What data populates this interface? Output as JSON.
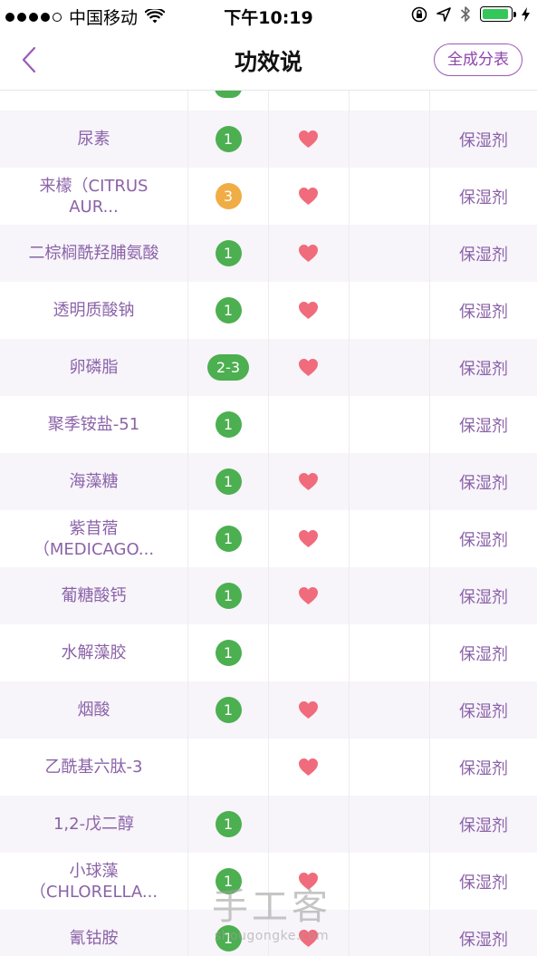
{
  "status_bar": {
    "carrier": "中国移动",
    "time": "下午10:19"
  },
  "nav": {
    "title": "功效说",
    "full_table_label": "全成分表"
  },
  "colors": {
    "accent": "#8e44ad",
    "ingredient_text": "#8b63a8",
    "safe_green": "#4caf50",
    "risk_orange": "#f0ad45",
    "heart_pink": "#f06b7b",
    "row_alt_bg": "#f7f4fa"
  },
  "rows": [
    {
      "name_lines": [
        "尿素"
      ],
      "score": "1",
      "score_color": "green",
      "acne_heart": true,
      "function": "保湿剂"
    },
    {
      "name_lines": [
        "来檬（CITRUS",
        "AUR..."
      ],
      "score": "3",
      "score_color": "orange",
      "acne_heart": true,
      "function": "保湿剂"
    },
    {
      "name_lines": [
        "二棕榈酰羟脯氨酸"
      ],
      "score": "1",
      "score_color": "green",
      "acne_heart": true,
      "function": "保湿剂"
    },
    {
      "name_lines": [
        "透明质酸钠"
      ],
      "score": "1",
      "score_color": "green",
      "acne_heart": true,
      "function": "保湿剂"
    },
    {
      "name_lines": [
        "卵磷脂"
      ],
      "score": "2-3",
      "score_color": "green",
      "acne_heart": true,
      "function": "保湿剂"
    },
    {
      "name_lines": [
        "聚季铵盐-51"
      ],
      "score": "1",
      "score_color": "green",
      "acne_heart": false,
      "function": "保湿剂"
    },
    {
      "name_lines": [
        "海藻糖"
      ],
      "score": "1",
      "score_color": "green",
      "acne_heart": true,
      "function": "保湿剂"
    },
    {
      "name_lines": [
        "紫苜蓿",
        "（MEDICAGO..."
      ],
      "score": "1",
      "score_color": "green",
      "acne_heart": true,
      "function": "保湿剂"
    },
    {
      "name_lines": [
        "葡糖酸钙"
      ],
      "score": "1",
      "score_color": "green",
      "acne_heart": true,
      "function": "保湿剂"
    },
    {
      "name_lines": [
        "水解藻胶"
      ],
      "score": "1",
      "score_color": "green",
      "acne_heart": false,
      "function": "保湿剂"
    },
    {
      "name_lines": [
        "烟酸"
      ],
      "score": "1",
      "score_color": "green",
      "acne_heart": true,
      "function": "保湿剂"
    },
    {
      "name_lines": [
        "乙酰基六肽-3"
      ],
      "score": "",
      "score_color": "green",
      "acne_heart": true,
      "function": "保湿剂"
    },
    {
      "name_lines": [
        "1,2-戊二醇"
      ],
      "score": "1",
      "score_color": "green",
      "acne_heart": false,
      "function": "保湿剂"
    },
    {
      "name_lines": [
        "小球藻",
        "（CHLORELLA..."
      ],
      "score": "1",
      "score_color": "green",
      "acne_heart": true,
      "function": "保湿剂"
    },
    {
      "name_lines": [
        "氰钴胺"
      ],
      "score": "1",
      "score_color": "green",
      "acne_heart": true,
      "function": "保湿剂"
    }
  ],
  "watermark": {
    "main": "手工客",
    "sub": "shougongke.com"
  }
}
